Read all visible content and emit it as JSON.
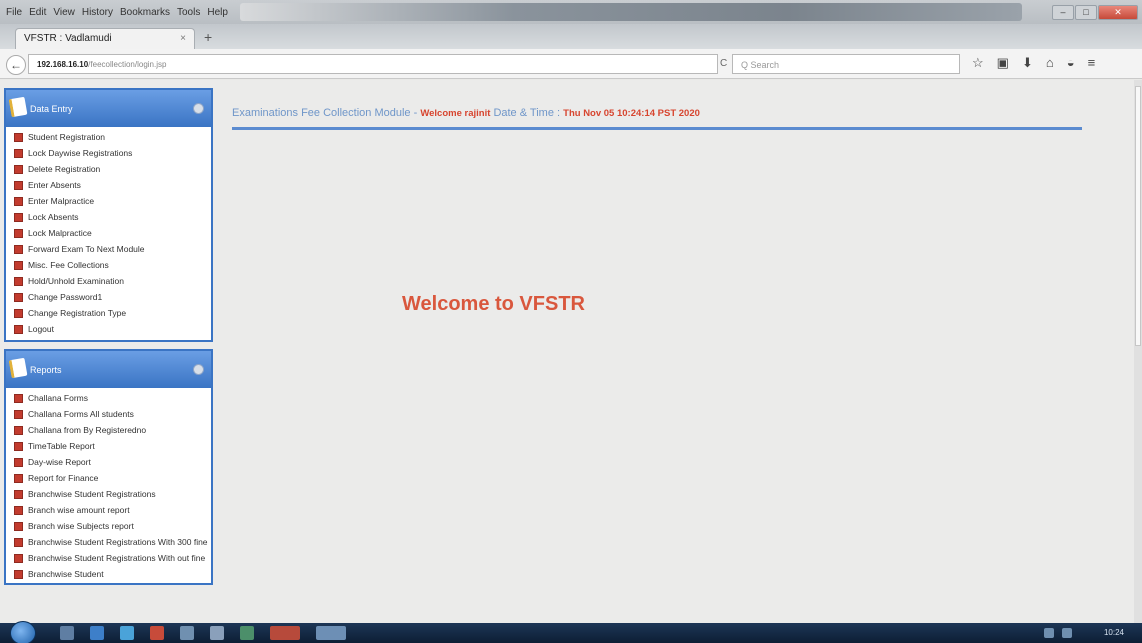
{
  "browser": {
    "menu": [
      "File",
      "Edit",
      "View",
      "History",
      "Bookmarks",
      "Tools",
      "Help"
    ],
    "tab_title": "VFSTR : Vadlamudi",
    "tab_close": "×",
    "new_tab": "+",
    "back": "←",
    "url_host": "192.168.16.10",
    "url_path": "/feecollection/login.jsp",
    "reload": "C",
    "search_placeholder": "Q Search",
    "toolbar_icons": [
      "☆",
      "▣",
      "⬇",
      "⌂",
      "◒",
      "≡"
    ]
  },
  "sidebar": {
    "data_entry": {
      "title": "Data Entry",
      "items": [
        "Student Registration",
        "Lock Daywise Registrations",
        "Delete Registration",
        "Enter Absents",
        "Enter Malpractice",
        "Lock Absents",
        "Lock Malpractice",
        "Forward Exam To Next Module",
        "Misc. Fee Collections",
        "Hold/Unhold Examination",
        "Change Password1",
        "Change Registration Type",
        "Logout"
      ]
    },
    "reports": {
      "title": "Reports",
      "items": [
        "Challana Forms",
        "Challana Forms All students",
        "Challana from By Registeredno",
        "TimeTable Report",
        "Day-wise Report",
        "Report for Finance",
        "Branchwise Student Registrations",
        "Branch wise amount report",
        "Branch wise Subjects report",
        "Branchwise Student Registrations With 300 fine",
        "Branchwise Student Registrations With out fine",
        "Branchwise Student"
      ]
    }
  },
  "header": {
    "module": "Examinations Fee Collection Module -",
    "welcome_user": "Welcome rajinit",
    "datetime_label": "Date & Time :",
    "datetime_value": "Thu Nov 05 10:24:14 PST 2020"
  },
  "main": {
    "welcome": "Welcome to VFSTR"
  },
  "taskbar": {
    "clock": "10:24"
  },
  "colors": {
    "panel_blue": "#3a74c4",
    "header_text": "#6f96c9",
    "accent_red": "#d9573d"
  }
}
